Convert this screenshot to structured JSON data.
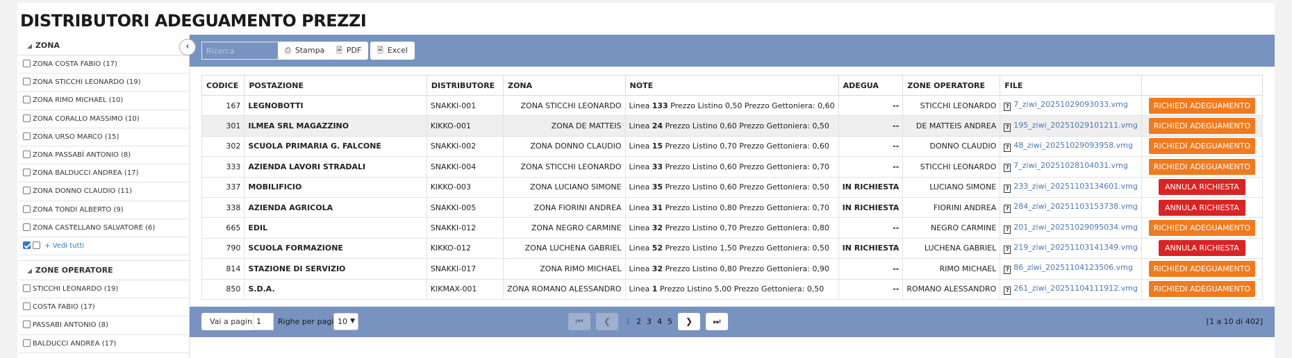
{
  "page": {
    "title": "DISTRIBUTORI ADEGUAMENTO PREZZI"
  },
  "sidebar": {
    "zona": {
      "header": "ZONA",
      "items": [
        "ZONA COSTA FABIO (17)",
        "ZONA STICCHI LEONARDO (19)",
        "ZONA RIMO MICHAEL (10)",
        "ZONA CORALLO MASSIMO (10)",
        "ZONA URSO MARCO (15)",
        "ZONA PASSABÌ ANTONIO (8)",
        "ZONA BALDUCCI ANDREA (17)",
        "ZONA DONNO CLAUDIO (11)",
        "ZONA TONDI ALBERTO (9)",
        "ZONA CASTELLANO SALVATORE (6)"
      ],
      "vedi_tutti": "+ Vedi tutti"
    },
    "operatori": {
      "header": "ZONE OPERATORE",
      "items": [
        "STICCHI LEONARDO (19)",
        "COSTA FABIO (17)",
        "PASSABI ANTONIO (8)",
        "BALDUCCI ANDREA (17)"
      ]
    }
  },
  "toolbar": {
    "search_placeholder": "Ricerca",
    "stampa": "Stampa",
    "pdf": "PDF",
    "excel": "Excel"
  },
  "table": {
    "headers": [
      "CODICE",
      "POSTAZIONE",
      "DISTRIBUTORE",
      "ZONA",
      "NOTE",
      "ADEGUA",
      "ZONE OPERATORE",
      "FILE",
      ""
    ],
    "rows": [
      {
        "codice": "167",
        "postazione": "LEGNOBOTTI",
        "distributore": "SNAKKI-001",
        "zona": "ZONA STICCHI LEONARDO",
        "note_pre": "Linea ",
        "note_num": "133",
        "note_post": " Prezzo Listino 0,50 Prezzo Gettoniera: 0,60",
        "adegua": "--",
        "operatore": "STICCHI LEONARDO",
        "file": "7_ziwi_20251029093033.vmg",
        "action": "RICHIEDI ADEGUAMENTO",
        "action_type": "req"
      },
      {
        "codice": "301",
        "postazione": "ILMEA SRL MAGAZZINO",
        "distributore": "KIKKO-001",
        "zona": "ZONA DE MATTEIS",
        "note_pre": "Linea ",
        "note_num": "24",
        "note_post": " Prezzo Listino 0,60 Prezzo Gettoniera: 0,50",
        "adegua": "--",
        "operatore": "DE MATTEIS ANDREA",
        "file": "195_ziwi_20251029101211.vmg",
        "action": "RICHIEDI ADEGUAMENTO",
        "action_type": "req"
      },
      {
        "codice": "302",
        "postazione": "SCUOLA PRIMARIA G. FALCONE",
        "distributore": "SNAKKI-002",
        "zona": "ZONA DONNO CLAUDIO",
        "note_pre": "Linea ",
        "note_num": "15",
        "note_post": " Prezzo Listino 0,70 Prezzo Gettoniera: 0,60",
        "adegua": "--",
        "operatore": "DONNO CLAUDIO",
        "file": "48_ziwi_20251029093958.vmg",
        "action": "RICHIEDI ADEGUAMENTO",
        "action_type": "req"
      },
      {
        "codice": "333",
        "postazione": "AZIENDA LAVORI STRADALI",
        "distributore": "SNAKKI-004",
        "zona": "ZONA STICCHI LEONARDO",
        "note_pre": "Linea ",
        "note_num": "33",
        "note_post": " Prezzo Listino 0,60 Prezzo Gettoniera: 0,70",
        "adegua": "--",
        "operatore": "STICCHI LEONARDO",
        "file": "7_ziwi_20251028104031.vmg",
        "action": "RICHIEDI ADEGUAMENTO",
        "action_type": "req"
      },
      {
        "codice": "337",
        "postazione": "MOBILIFICIO",
        "distributore": "KIKKO-003",
        "zona": "ZONA LUCIANO SIMONE",
        "note_pre": "Linea ",
        "note_num": "35",
        "note_post": " Prezzo Listino 0,60 Prezzo Gettoniera: 0,50",
        "adegua": "IN RICHIESTA",
        "operatore": "LUCIANO SIMONE",
        "file": "233_ziwi_20251103134601.vmg",
        "action": "ANNULA RICHIESTA",
        "action_type": "ann"
      },
      {
        "codice": "338",
        "postazione": "AZIENDA AGRICOLA",
        "distributore": "SNAKKI-005",
        "zona": "ZONA FIORINI ANDREA",
        "note_pre": "Linea ",
        "note_num": "31",
        "note_post": " Prezzo Listino 0,80 Prezzo Gettoniera: 0,70",
        "adegua": "IN RICHIESTA",
        "operatore": "FIORINI ANDREA",
        "file": "284_ziwi_20251103153738.vmg",
        "action": "ANNULA RICHIESTA",
        "action_type": "ann"
      },
      {
        "codice": "665",
        "postazione": "EDIL",
        "distributore": "SNAKKI-012",
        "zona": "ZONA NEGRO CARMINE",
        "note_pre": "Linea ",
        "note_num": "32",
        "note_post": " Prezzo Listino 0,70 Prezzo Gettoniera: 0,80",
        "adegua": "--",
        "operatore": "NEGRO CARMINE",
        "file": "201_ziwi_20251029095034.vmg",
        "action": "RICHIEDI ADEGUAMENTO",
        "action_type": "req"
      },
      {
        "codice": "790",
        "postazione": "SCUOLA FORMAZIONE",
        "distributore": "KIKKO-012",
        "zona": "ZONA LUCHENA GABRIEL",
        "note_pre": "Linea ",
        "note_num": "52",
        "note_post": " Prezzo Listino 1,50 Prezzo Gettoniera: 0,50",
        "adegua": "IN RICHIESTA",
        "operatore": "LUCHENA GABRIEL",
        "file": "219_ziwi_20251103141349.vmg",
        "action": "ANNULA RICHIESTA",
        "action_type": "ann"
      },
      {
        "codice": "814",
        "postazione": "STAZIONE DI SERVIZIO",
        "distributore": "SNAKKI-017",
        "zona": "ZONA RIMO MICHAEL",
        "note_pre": "Linea ",
        "note_num": "32",
        "note_post": " Prezzo Listino 0,80 Prezzo Gettoniera: 0,90",
        "adegua": "--",
        "operatore": "RIMO MICHAEL",
        "file": "86_ziwi_20251104123506.vmg",
        "action": "RICHIEDI ADEGUAMENTO",
        "action_type": "req"
      },
      {
        "codice": "850",
        "postazione": "S.D.A.",
        "distributore": "KIKMAX-001",
        "zona": "ZONA ROMANO ALESSANDRO",
        "note_pre": "Linea ",
        "note_num": "1",
        "note_post": " Prezzo Listino 5,00 Prezzo Gettoniera: 0,50",
        "adegua": "--",
        "operatore": "ROMANO ALESSANDRO",
        "file": "261_ziwi_20251104111912.vmg",
        "action": "RICHIEDI ADEGUAMENTO",
        "action_type": "req"
      }
    ]
  },
  "footer": {
    "vai_a_pagina": "Vai a pagina",
    "page_value": "1",
    "righe_label": "Righe per pagina",
    "righe_value": "10",
    "pages": [
      "1",
      "2",
      "3",
      "4",
      "5"
    ],
    "current_page": "1",
    "count": "[1 a 10 di 402]"
  },
  "colors": {
    "accent_bar": "#7893c0",
    "request_button": "#f07a1e",
    "cancel_button": "#d92424",
    "link": "#4a78b8"
  }
}
